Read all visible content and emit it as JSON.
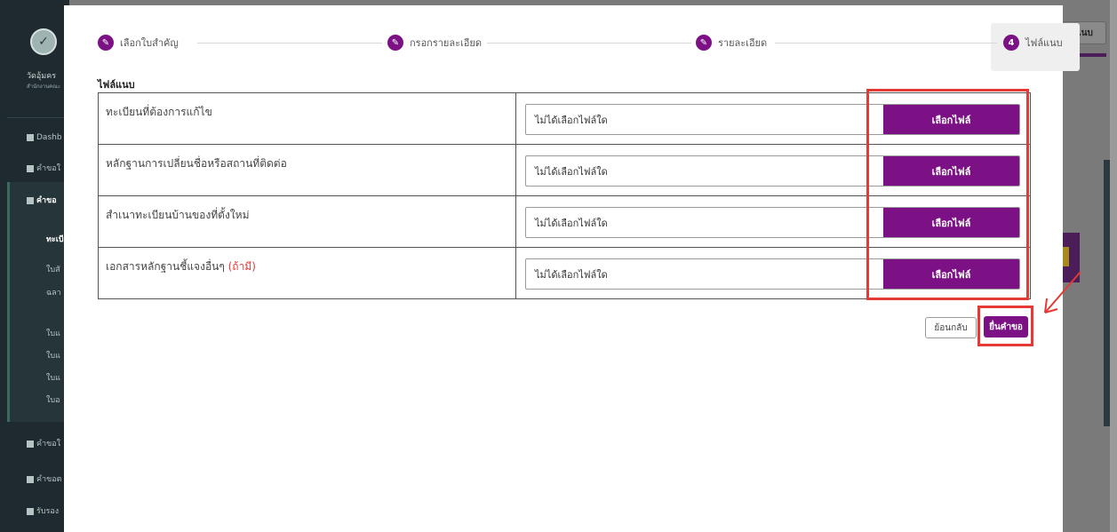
{
  "background": {
    "brand_name": "วัดอุ้มคร",
    "brand_sub": "สำนักงานคณะ",
    "top_button": "แนบ",
    "nav": [
      {
        "icon": "dashboard-icon",
        "label": "Dashb"
      },
      {
        "icon": "document-icon",
        "label": "คำขอใ"
      },
      {
        "icon": "edit-icon",
        "label": "คำขอ"
      },
      {
        "icon": "",
        "label": "ทะเบี"
      },
      {
        "icon": "",
        "label": "ใบสั"
      },
      {
        "icon": "",
        "label": "ฉลา"
      },
      {
        "icon": "",
        "label": "ใบแ"
      },
      {
        "icon": "",
        "label": "ใบแ"
      },
      {
        "icon": "",
        "label": "ใบแ"
      },
      {
        "icon": "",
        "label": "ใบอ"
      },
      {
        "icon": "copy-icon",
        "label": "คำขอใ"
      },
      {
        "icon": "file-icon",
        "label": "คำขอต"
      },
      {
        "icon": "card-icon",
        "label": "รับรอง"
      }
    ]
  },
  "stepper": {
    "steps": [
      {
        "label": "เลือกใบสำคัญ",
        "icon": "pencil-icon",
        "number": ""
      },
      {
        "label": "กรอกรายละเอียด",
        "icon": "pencil-icon",
        "number": ""
      },
      {
        "label": "รายละเอียด",
        "icon": "pencil-icon",
        "number": ""
      },
      {
        "label": "ไฟล์แนบ",
        "icon": "",
        "number": "4"
      }
    ]
  },
  "attachments": {
    "title": "ไฟล์แนบ",
    "rows": [
      {
        "label": "ทะเบียนที่ต้องการแก้ไข",
        "optional": "",
        "file_name": "ไม่ได้เลือกไฟล์ใด",
        "button": "เลือกไฟล์"
      },
      {
        "label": "หลักฐานการเปลี่ยนชื่อหรือสถานที่ติดต่อ",
        "optional": "",
        "file_name": "ไม่ได้เลือกไฟล์ใด",
        "button": "เลือกไฟล์"
      },
      {
        "label": "สำเนาทะเบียนบ้านของที่ตั้งใหม่",
        "optional": "",
        "file_name": "ไม่ได้เลือกไฟล์ใด",
        "button": "เลือกไฟล์"
      },
      {
        "label": "เอกสารหลักฐานชี้แจงอื่นๆ ",
        "optional": "(ถ้ามี)",
        "file_name": "ไม่ได้เลือกไฟล์ใด",
        "button": "เลือกไฟล์"
      }
    ]
  },
  "actions": {
    "back_label": "ย้อนกลับ",
    "submit_label": "ยื่นคำขอ"
  },
  "colors": {
    "accent": "#7b1185",
    "annotation": "#e53935"
  }
}
